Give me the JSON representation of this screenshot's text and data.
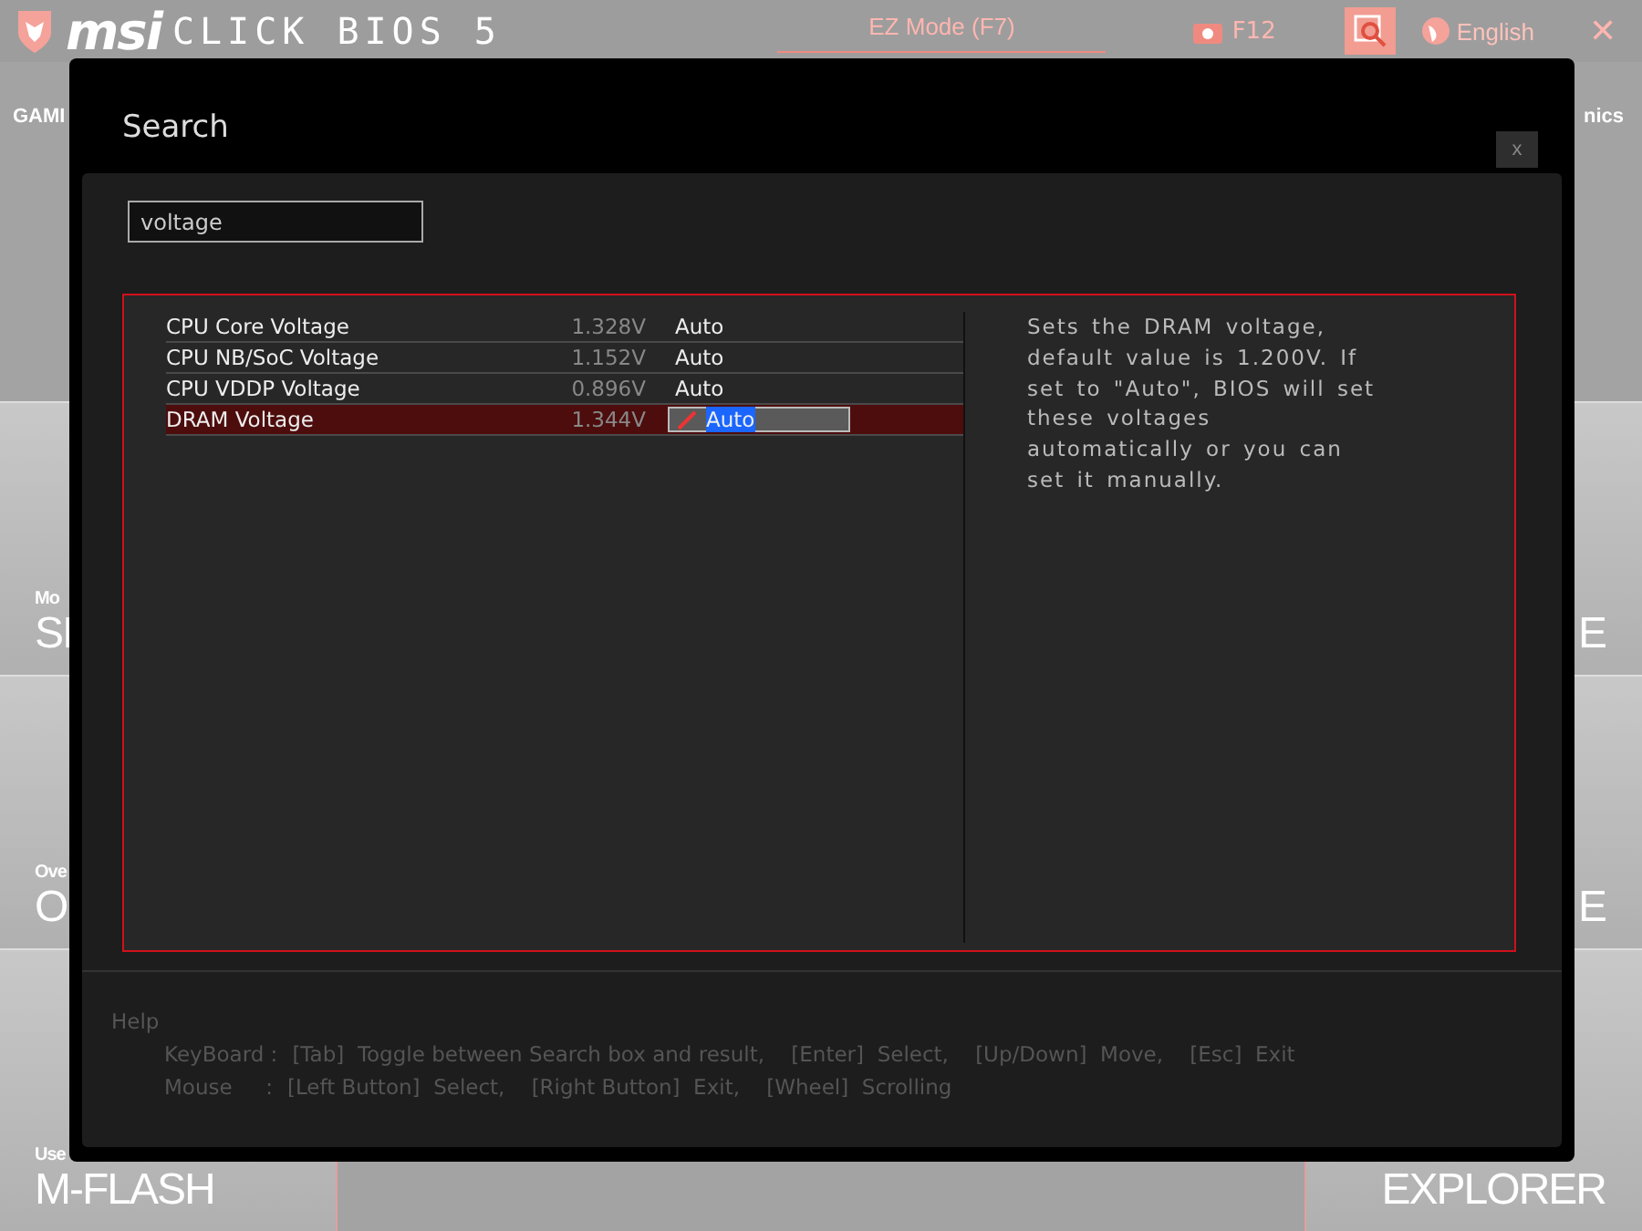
{
  "header": {
    "logo": "msi",
    "product": "CLICK BIOS 5",
    "mode_button": "EZ Mode (F7)",
    "screenshot_key": "F12",
    "language": "English",
    "close": "✕"
  },
  "background": {
    "top_left": "GAMI",
    "top_right": "nics",
    "tiles_left": [
      {
        "caption": "Mo",
        "title": "SI"
      },
      {
        "caption": "Ove",
        "title": "O"
      },
      {
        "caption": "Use",
        "title": "M-FLASH"
      }
    ],
    "tiles_right": [
      {
        "title": "E"
      },
      {
        "title": "E"
      },
      {
        "title": "EXPLORER"
      }
    ]
  },
  "dialog": {
    "title": "Search",
    "close": "x",
    "search": {
      "value": "voltage"
    },
    "results": [
      {
        "name": "CPU Core Voltage",
        "reading": "1.328V",
        "setting": "Auto",
        "selected": false
      },
      {
        "name": "CPU NB/SoC Voltage",
        "reading": "1.152V",
        "setting": "Auto",
        "selected": false
      },
      {
        "name": "CPU VDDP Voltage",
        "reading": "0.896V",
        "setting": "Auto",
        "selected": false
      },
      {
        "name": "DRAM Voltage",
        "reading": "1.344V",
        "setting": "Auto",
        "selected": true
      }
    ],
    "description": "Sets the DRAM voltage, default value is 1.200V. If set to \"Auto\", BIOS will set these voltages automatically or you can set it manually.",
    "help": {
      "title": "Help",
      "lines": [
        {
          "label": "KeyBoard :",
          "text": "[Tab]  Toggle between Search box and result,    [Enter]  Select,    [Up/Down]  Move,    [Esc]  Exit"
        },
        {
          "label": "Mouse     :",
          "text": "[Left Button]  Select,    [Right Button]  Exit,    [Wheel]  Scrolling"
        }
      ]
    }
  }
}
